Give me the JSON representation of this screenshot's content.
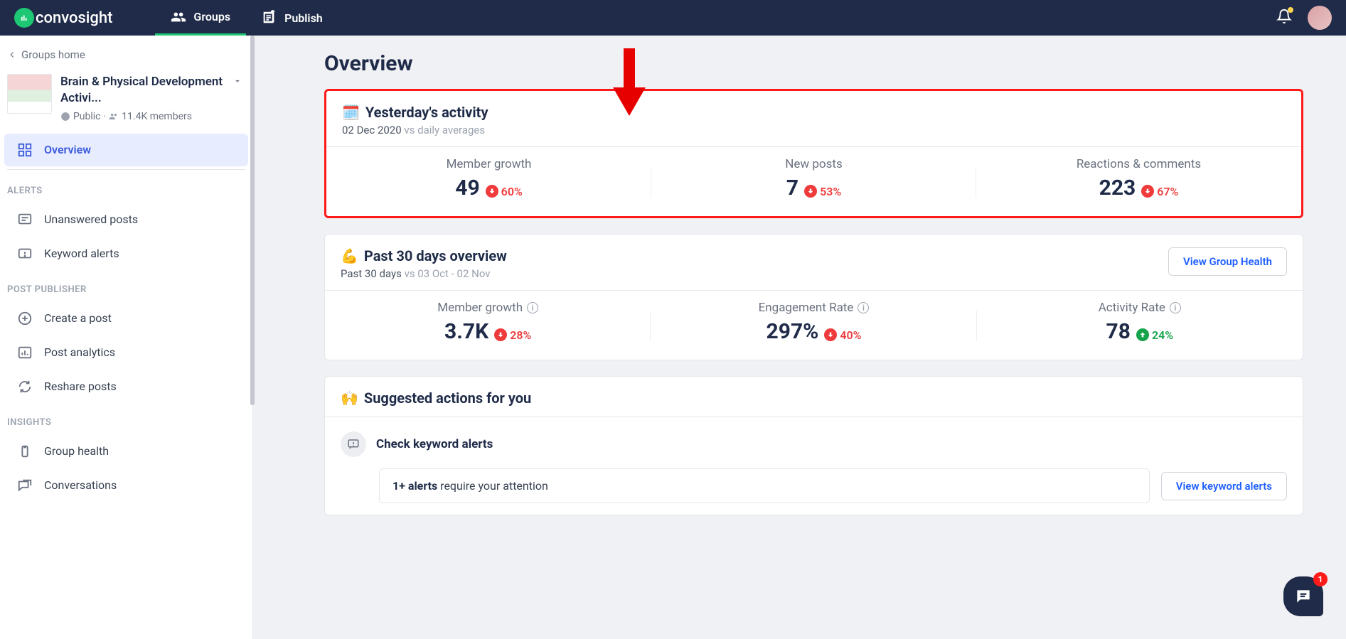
{
  "brand": {
    "name": "convosight"
  },
  "nav": {
    "groups": "Groups",
    "publish": "Publish"
  },
  "sidebar": {
    "back": "Groups home",
    "group_title": "Brain & Physical Development Activi...",
    "visibility": "Public",
    "members": "11.4K members",
    "items": {
      "overview": "Overview"
    },
    "sections": {
      "alerts": "ALERTS",
      "post_publisher": "POST PUBLISHER",
      "insights": "INSIGHTS"
    },
    "alerts": {
      "unanswered": "Unanswered posts",
      "keyword": "Keyword alerts"
    },
    "publisher": {
      "create": "Create a post",
      "analytics": "Post analytics",
      "reshare": "Reshare posts"
    },
    "insights": {
      "health": "Group health",
      "conversations": "Conversations"
    }
  },
  "main": {
    "title": "Overview",
    "yesterday": {
      "emoji": "🗓️",
      "title": "Yesterday's activity",
      "date": "02 Dec 2020",
      "vs": " vs daily averages",
      "metrics": [
        {
          "label": "Member growth",
          "value": "49",
          "delta": "60%",
          "dir": "down"
        },
        {
          "label": "New posts",
          "value": "7",
          "delta": "53%",
          "dir": "down"
        },
        {
          "label": "Reactions & comments",
          "value": "223",
          "delta": "67%",
          "dir": "down"
        }
      ]
    },
    "past30": {
      "emoji": "💪",
      "title": "Past 30 days overview",
      "sub": "Past 30 days",
      "vs": " vs 03 Oct - 02 Nov",
      "button": "View Group Health",
      "metrics": [
        {
          "label": "Member growth",
          "value": "3.7K",
          "delta": "28%",
          "dir": "down",
          "info": true
        },
        {
          "label": "Engagement Rate",
          "value": "297%",
          "delta": "40%",
          "dir": "down",
          "info": true
        },
        {
          "label": "Activity Rate",
          "value": "78",
          "delta": "24%",
          "dir": "up",
          "info": true
        }
      ]
    },
    "suggested": {
      "emoji": "🙌",
      "title": "Suggested actions for you",
      "action1_title": "Check keyword alerts",
      "action1_count": "1+ alerts",
      "action1_rest": " require your attention",
      "action1_btn": "View keyword alerts"
    }
  },
  "chat_badge": "1"
}
